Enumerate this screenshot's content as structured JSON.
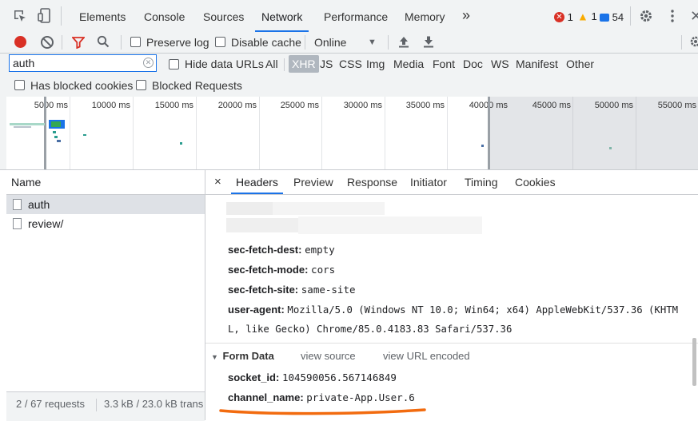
{
  "tabbar": {
    "tabs": [
      "Elements",
      "Console",
      "Sources",
      "Network",
      "Performance",
      "Memory"
    ],
    "more": "»",
    "errors": "1",
    "warnings": "1",
    "messages": "54",
    "colors": {
      "error": "#d93025",
      "warning": "#f9ab00",
      "message": "#1a73e8",
      "accent": "#1a73e8"
    }
  },
  "toolbar": {
    "preserve_log": "Preserve log",
    "disable_cache": "Disable cache",
    "throttle": "Online",
    "throttle_arrow": "▼"
  },
  "filter": {
    "value": "auth",
    "hide_data_urls": "Hide data URLs",
    "types": [
      "All",
      "XHR",
      "JS",
      "CSS",
      "Img",
      "Media",
      "Font",
      "Doc",
      "WS",
      "Manifest",
      "Other"
    ],
    "selected_type": "XHR",
    "has_blocked_cookies": "Has blocked cookies",
    "blocked_requests": "Blocked Requests"
  },
  "overview": {
    "ticks": [
      "5000 ms",
      "10000 ms",
      "15000 ms",
      "20000 ms",
      "25000 ms",
      "30000 ms",
      "35000 ms",
      "40000 ms",
      "45000 ms",
      "50000 ms",
      "55000 ms"
    ]
  },
  "requests": {
    "header": "Name",
    "items": [
      "auth",
      "review/"
    ],
    "status_count": "2 / 67 requests",
    "status_size": "3.3 kB / 23.0 kB trans"
  },
  "details": {
    "close": "×",
    "tabs": [
      "Headers",
      "Preview",
      "Response",
      "Initiator",
      "Timing",
      "Cookies"
    ],
    "headers": [
      {
        "name": "sec-fetch-dest:",
        "value": "empty"
      },
      {
        "name": "sec-fetch-mode:",
        "value": "cors"
      },
      {
        "name": "sec-fetch-site:",
        "value": "same-site"
      },
      {
        "name": "user-agent:",
        "value": "Mozilla/5.0 (Windows NT 10.0; Win64; x64) AppleWebKit/537.36 (KHTM",
        "value2": "L, like Gecko) Chrome/85.0.4183.83 Safari/537.36"
      }
    ],
    "form_data": {
      "title": "Form Data",
      "view_source": "view source",
      "view_url_encoded": "view URL encoded",
      "fields": [
        {
          "name": "socket_id:",
          "value": "104590056.567146849"
        },
        {
          "name": "channel_name:",
          "value": "private-App.User.6"
        }
      ]
    },
    "highlight_color": "#f26b0f"
  }
}
